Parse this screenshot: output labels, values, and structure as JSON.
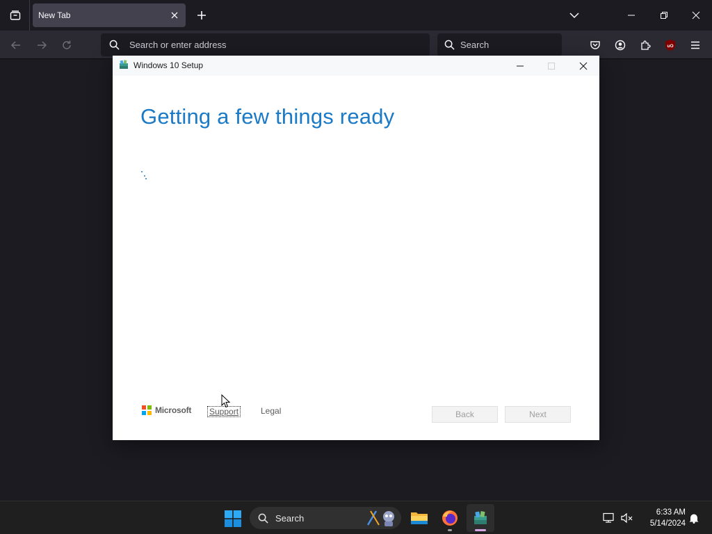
{
  "browser": {
    "tab": {
      "title": "New Tab"
    },
    "urlbar": {
      "placeholder": "Search or enter address"
    },
    "searchbar": {
      "placeholder": "Search"
    },
    "extension_badge": "uO"
  },
  "setup_window": {
    "title": "Windows 10 Setup",
    "heading": "Getting a few things ready",
    "footer": {
      "brand": "Microsoft",
      "support_label": "Support",
      "legal_label": "Legal"
    },
    "buttons": {
      "back": "Back",
      "next": "Next"
    },
    "accent_color": "#1b7ac6"
  },
  "taskbar": {
    "search_label": "Search",
    "apps": [
      "file-explorer",
      "firefox",
      "windows-setup"
    ],
    "clock": {
      "time": "6:33 AM",
      "date": "5/14/2024"
    }
  }
}
